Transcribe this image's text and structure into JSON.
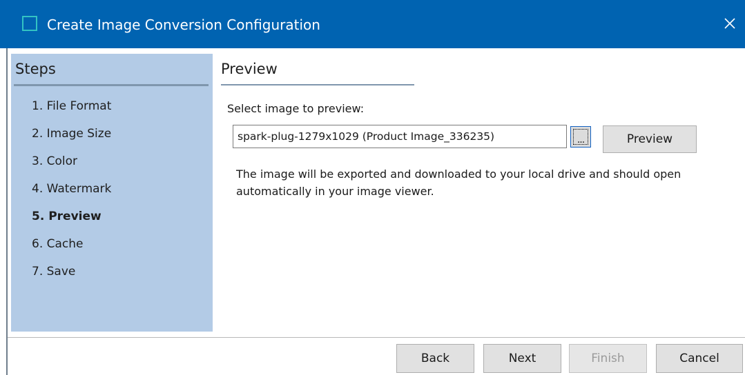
{
  "window": {
    "title": "Create Image Conversion Configuration",
    "close_icon": "close-icon",
    "accent_color": "#0063b1"
  },
  "sidebar": {
    "title": "Steps",
    "background_color": "#b3cbe6",
    "items": [
      {
        "label": "1. File Format",
        "active": false
      },
      {
        "label": "2. Image Size",
        "active": false
      },
      {
        "label": "3. Color",
        "active": false
      },
      {
        "label": "4. Watermark",
        "active": false
      },
      {
        "label": "5. Preview",
        "active": true
      },
      {
        "label": "6. Cache",
        "active": false
      },
      {
        "label": "7. Save",
        "active": false
      }
    ]
  },
  "main": {
    "section_title": "Preview",
    "select_label": "Select image to preview:",
    "image_value": "spark-plug-1279x1029 (Product Image_336235)",
    "browse_label": "...",
    "preview_button": "Preview",
    "info_text": "The image will be exported and downloaded to your local drive and should open automatically in your image viewer."
  },
  "footer": {
    "back": "Back",
    "next": "Next",
    "finish": "Finish",
    "cancel": "Cancel"
  }
}
